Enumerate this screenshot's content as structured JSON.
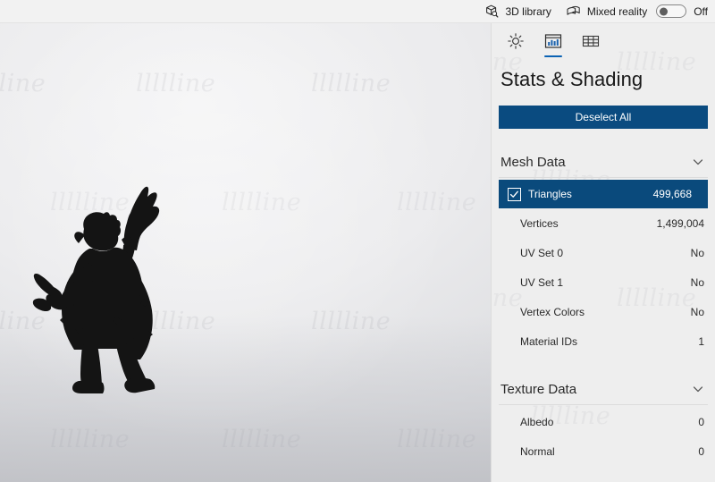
{
  "topbar": {
    "library": {
      "label": "3D library",
      "icon": "cube-search-icon"
    },
    "mixed_reality": {
      "label": "Mixed reality",
      "icon": "mixed-reality-icon",
      "toggle_state": "Off",
      "toggle_on": false
    }
  },
  "panel": {
    "tabs": [
      {
        "name": "lighting",
        "icon": "sun-light-icon",
        "active": false
      },
      {
        "name": "stats",
        "icon": "bar-chart-icon",
        "active": true
      },
      {
        "name": "wireframe",
        "icon": "grid-mesh-icon",
        "active": false
      }
    ],
    "title": "Stats & Shading",
    "deselect_button": "Deselect All",
    "sections": [
      {
        "title": "Mesh Data",
        "chevron": "chevron-down-icon",
        "rows": [
          {
            "label": "Triangles",
            "value": "499,668",
            "selected": true,
            "checked": true
          },
          {
            "label": "Vertices",
            "value": "1,499,004",
            "selected": false,
            "checked": false
          },
          {
            "label": "UV Set 0",
            "value": "No",
            "selected": false,
            "checked": false
          },
          {
            "label": "UV Set 1",
            "value": "No",
            "selected": false,
            "checked": false
          },
          {
            "label": "Vertex Colors",
            "value": "No",
            "selected": false,
            "checked": false
          },
          {
            "label": "Material IDs",
            "value": "1",
            "selected": false,
            "checked": false
          }
        ]
      },
      {
        "title": "Texture Data",
        "chevron": "chevron-down-icon",
        "rows": [
          {
            "label": "Albedo",
            "value": "0",
            "selected": false,
            "checked": false
          },
          {
            "label": "Normal",
            "value": "0",
            "selected": false,
            "checked": false
          }
        ]
      }
    ]
  },
  "viewport": {
    "model_name": "armored-warrior-silhouette",
    "watermark_text": "llllline"
  },
  "colors": {
    "accent_blue": "#0a4b80",
    "tab_underline": "#0a62b4",
    "panel_bg": "#eeeeee",
    "topbar_bg": "#f2f2f2",
    "selected_row": "#0a4a7c"
  }
}
